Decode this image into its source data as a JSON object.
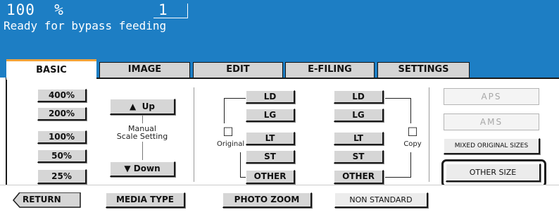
{
  "header": {
    "zoom": "100  %",
    "copies": "1",
    "status": "Ready for bypass feeding"
  },
  "tabs": [
    "BASIC",
    "IMAGE",
    "EDIT",
    "E-FILING",
    "SETTINGS"
  ],
  "zoom_presets": [
    "400%",
    "200%",
    "100%",
    "50%",
    "25%"
  ],
  "manual": {
    "up": "Up",
    "down": "Down",
    "label_line1": "Manual",
    "label_line2": "Scale Setting"
  },
  "original": {
    "label": "Original",
    "sizes": [
      "LD",
      "LG",
      "LT",
      "ST",
      "OTHER"
    ]
  },
  "copy": {
    "label": "Copy",
    "sizes": [
      "LD",
      "LG",
      "LT",
      "ST",
      "OTHER"
    ]
  },
  "right": {
    "aps": "APS",
    "ams": "AMS",
    "mixed": "MIXED ORIGINAL SIZES",
    "other_size": "OTHER SIZE"
  },
  "bottom": {
    "return": "RETURN",
    "media_type": "MEDIA TYPE",
    "photo_zoom": "PHOTO ZOOM",
    "non_standard": "NON STANDARD"
  }
}
